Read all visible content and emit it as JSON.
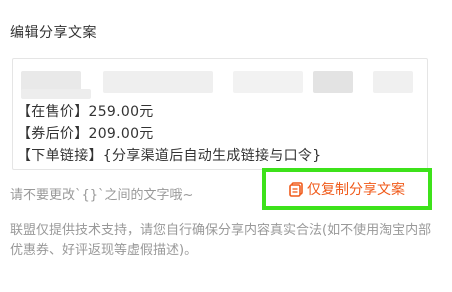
{
  "header": {
    "title": "编辑分享文案"
  },
  "card": {
    "lines": [
      "【在售价】259.00元",
      "【券后价】209.00元",
      "【下单链接】{分享渠道后自动生成链接与口令}"
    ]
  },
  "hint": "请不要更改`{}`之间的文字哦~",
  "copy_button": {
    "label": "仅复制分享文案",
    "icon": "copy-icon",
    "color": "#f05a1a",
    "highlight": "#3de21a"
  },
  "disclaimer": "联盟仅提供技术支持，请您自行确保分享内容真实合法(如不使用淘宝内部优惠券、好评返现等虚假描述)。"
}
